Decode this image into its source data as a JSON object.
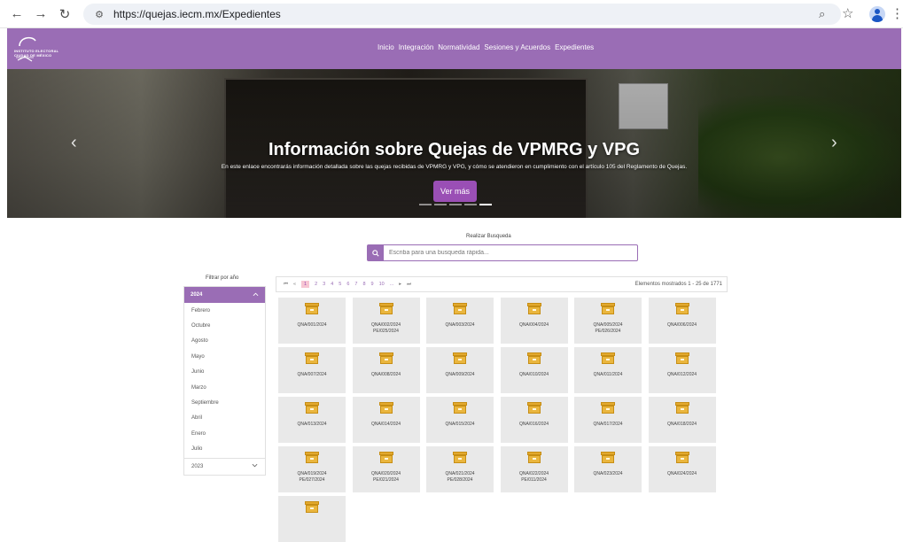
{
  "browser": {
    "url": "https://quejas.iecm.mx/Expedientes"
  },
  "header": {
    "logo_line1": "INSTITUTO ELECTORAL",
    "logo_line2": "CIUDAD DE MÉXICO",
    "nav": [
      "Inicio",
      "Integración",
      "Normatividad",
      "Sesiones y Acuerdos",
      "Expedientes"
    ]
  },
  "hero": {
    "title": "Información sobre Quejas de VPMRG y VPG",
    "subtitle": "En este enlace encontrarás información detallada sobre las quejas recibidas de VPMRG y VPG, y cómo se atendieron en cumplimiento con el artículo 105 del Reglamento de Quejas.",
    "button": "Ver más",
    "prev": "‹",
    "next": "›"
  },
  "search": {
    "label": "Realizar Busqueda",
    "placeholder": "Escriba para una busqueda rápida..."
  },
  "sidebar": {
    "title": "Filtrar por año",
    "year_active": "2024",
    "months": [
      "Febrero",
      "Octubre",
      "Agosto",
      "Mayo",
      "Junio",
      "Marzo",
      "Septiembre",
      "Abril",
      "Enero",
      "Julio"
    ],
    "year_collapsed": "2023"
  },
  "pager": {
    "first": "⏮",
    "prev": "«",
    "pages": [
      "1",
      "2",
      "3",
      "4",
      "5",
      "6",
      "7",
      "8",
      "9",
      "10",
      "..."
    ],
    "next": "▸",
    "last": "⏭",
    "info": "Elementos mostrados 1 - 25 de 1771"
  },
  "records": [
    {
      "l1": "QNA/001/2024",
      "l2": ""
    },
    {
      "l1": "QNA/002/2024",
      "l2": "PE/025/2024"
    },
    {
      "l1": "QNA/003/2024",
      "l2": ""
    },
    {
      "l1": "QNA/004/2024",
      "l2": ""
    },
    {
      "l1": "QNA/005/2024",
      "l2": "PE/026/2024"
    },
    {
      "l1": "QNA/006/2024",
      "l2": ""
    },
    {
      "l1": "QNA/007/2024",
      "l2": ""
    },
    {
      "l1": "QNA/008/2024",
      "l2": ""
    },
    {
      "l1": "QNA/009/2024",
      "l2": ""
    },
    {
      "l1": "QNA/010/2024",
      "l2": ""
    },
    {
      "l1": "QNA/011/2024",
      "l2": ""
    },
    {
      "l1": "QNA/012/2024",
      "l2": ""
    },
    {
      "l1": "QNA/013/2024",
      "l2": ""
    },
    {
      "l1": "QNA/014/2024",
      "l2": ""
    },
    {
      "l1": "QNA/015/2024",
      "l2": ""
    },
    {
      "l1": "QNA/016/2024",
      "l2": ""
    },
    {
      "l1": "QNA/017/2024",
      "l2": ""
    },
    {
      "l1": "QNA/018/2024",
      "l2": ""
    },
    {
      "l1": "QNA/019/2024",
      "l2": "PE/027/2024"
    },
    {
      "l1": "QNA/020/2024",
      "l2": "PE/021/2024"
    },
    {
      "l1": "QNA/021/2024",
      "l2": "PE/028/2024"
    },
    {
      "l1": "QNA/022/2024",
      "l2": "PE/011/2024"
    },
    {
      "l1": "QNA/023/2024",
      "l2": ""
    },
    {
      "l1": "QNA/024/2024",
      "l2": ""
    },
    {
      "l1": "",
      "l2": ""
    }
  ]
}
